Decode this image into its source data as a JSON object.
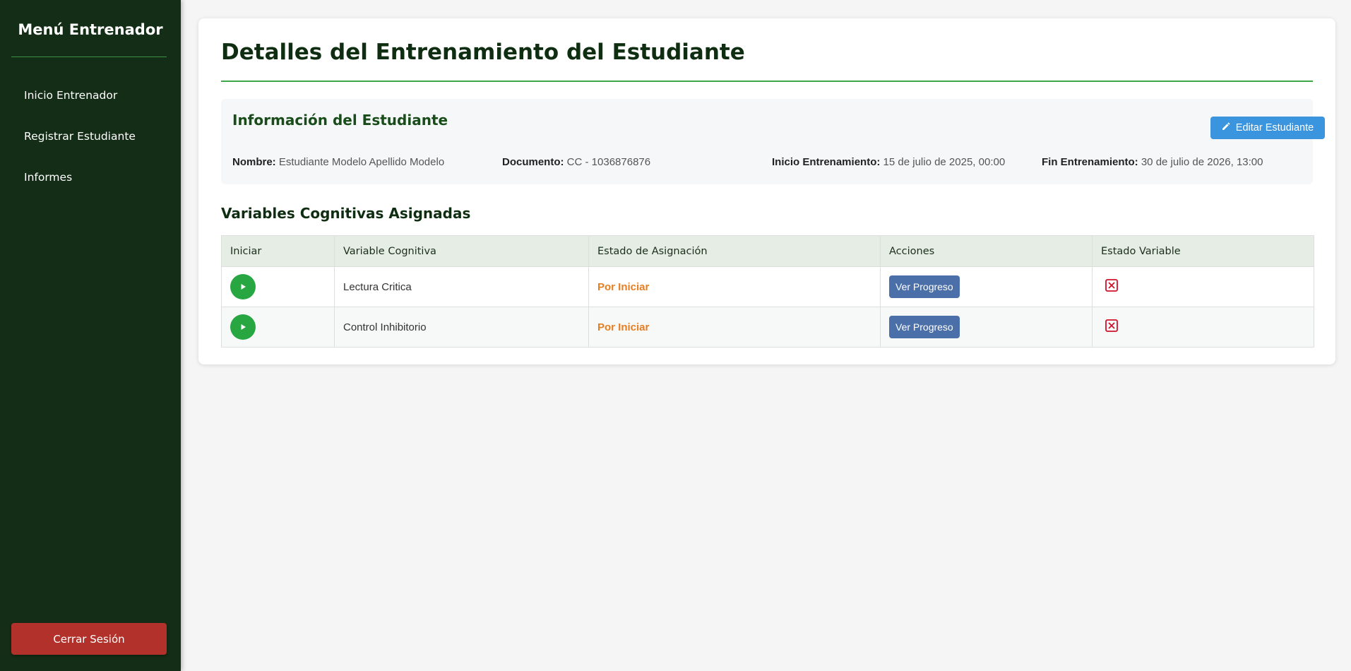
{
  "sidebar": {
    "title": "Menú Entrenador",
    "items": [
      {
        "label": "Inicio Entrenador"
      },
      {
        "label": "Registrar Estudiante"
      },
      {
        "label": "Informes"
      }
    ],
    "logout_label": "Cerrar Sesión"
  },
  "main": {
    "title": "Detalles del Entrenamiento del Estudiante",
    "student_info": {
      "title": "Información del Estudiante",
      "edit_button": {
        "label": "Editar Estudiante",
        "icon": "pencil-icon"
      },
      "fields": [
        {
          "label": "Nombre:",
          "value": "Estudiante Modelo Apellido Modelo"
        },
        {
          "label": "Documento:",
          "value": "CC - 1036876876"
        },
        {
          "label": "Inicio Entrenamiento:",
          "value": "15 de julio de 2025, 00:00"
        },
        {
          "label": "Fin Entrenamiento:",
          "value": "30 de julio de 2026, 13:00"
        }
      ]
    },
    "variables": {
      "title": "Variables Cognitivas Asignadas",
      "columns": [
        "Iniciar",
        "Variable Cognitiva",
        "Estado de Asignación",
        "Acciones",
        "Estado Variable"
      ],
      "rows": [
        {
          "variable": "Lectura Critica",
          "status": "Por Iniciar",
          "action": "Ver Progreso",
          "state_icon": "x-square-icon"
        },
        {
          "variable": "Control Inhibitorio",
          "status": "Por Iniciar",
          "action": "Ver Progreso",
          "state_icon": "x-square-icon"
        }
      ]
    }
  },
  "colors": {
    "sidebar_bg": "#142d16",
    "accent_green": "#3ea847",
    "edit_button": "#3a95de",
    "progress_button": "#4a6fa9",
    "status_pending": "#e67e22",
    "logout": "#b2322b",
    "x_icon": "#d0112b"
  }
}
